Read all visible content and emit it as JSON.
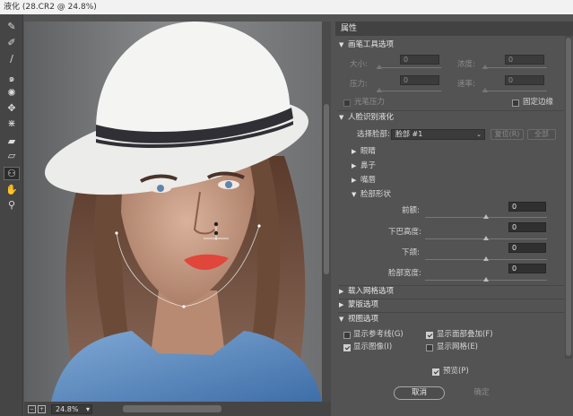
{
  "window": {
    "title": "液化 (28.CR2 @ 24.8%)"
  },
  "toolbar": {
    "tools": [
      {
        "name": "forward-warp-tool",
        "glyph": "✎"
      },
      {
        "name": "reconstruct-tool",
        "glyph": "✐"
      },
      {
        "name": "smooth-tool",
        "glyph": "∕"
      },
      {
        "name": "twirl-tool",
        "glyph": "๑"
      },
      {
        "name": "pucker-tool",
        "glyph": "✺"
      },
      {
        "name": "bloat-tool",
        "glyph": "✥"
      },
      {
        "name": "push-left-tool",
        "glyph": "⋇"
      },
      {
        "name": "freeze-mask-tool",
        "glyph": "▰"
      },
      {
        "name": "thaw-mask-tool",
        "glyph": "▱"
      },
      {
        "name": "face-tool",
        "glyph": "⚇"
      },
      {
        "name": "hand-tool",
        "glyph": "✋"
      },
      {
        "name": "zoom-tool",
        "glyph": "⚲"
      }
    ]
  },
  "canvas": {
    "zoom": "24.8%"
  },
  "panel": {
    "header": "属性",
    "brush_section": {
      "title": "画笔工具选项",
      "size_label": "大小:",
      "size_value": "0",
      "density_label": "浓度:",
      "density_value": "0",
      "pressure_label": "压力:",
      "pressure_value": "0",
      "rate_label": "速率:",
      "rate_value": "0",
      "stylus_label": "光笔压力",
      "pin_edges_label": "固定边缘"
    },
    "face_section": {
      "title": "人脸识别液化",
      "select_face_label": "选择脸部:",
      "select_face_value": "脸部 #1",
      "reset_label": "复位(R)",
      "all_label": "全部",
      "eyes_label": "眼睛",
      "nose_label": "鼻子",
      "mouth_label": "嘴唇",
      "face_shape_label": "脸部形状",
      "forehead_label": "前额:",
      "forehead_value": "0",
      "chin_height_label": "下巴高度:",
      "chin_height_value": "0",
      "jawline_label": "下颌:",
      "jawline_value": "0",
      "face_width_label": "脸部宽度:",
      "face_width_value": "0"
    },
    "load_mesh_label": "载入网格选项",
    "mask_label": "蒙版选项",
    "view_section": {
      "title": "视图选项",
      "show_guides": "显示参考线(G)",
      "show_face_overlay": "显示面部叠加(F)",
      "show_image": "显示图像(I)",
      "show_mesh": "显示网格(E)"
    }
  },
  "footer": {
    "preview_label": "预览(P)",
    "cancel_label": "取消",
    "ok_label": "确定"
  }
}
